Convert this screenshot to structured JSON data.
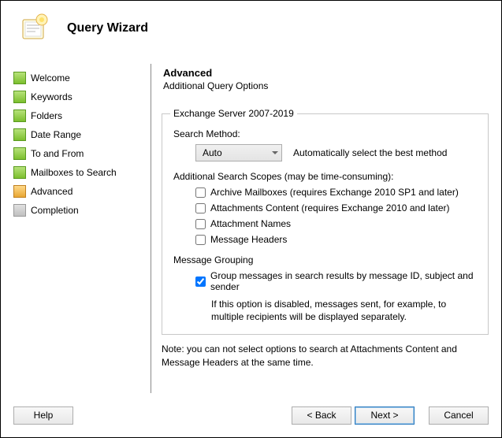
{
  "header": {
    "title": "Query Wizard"
  },
  "sidebar": {
    "items": [
      {
        "label": "Welcome",
        "state": "done"
      },
      {
        "label": "Keywords",
        "state": "done"
      },
      {
        "label": "Folders",
        "state": "done"
      },
      {
        "label": "Date Range",
        "state": "done"
      },
      {
        "label": "To and From",
        "state": "done"
      },
      {
        "label": "Mailboxes to Search",
        "state": "done"
      },
      {
        "label": "Advanced",
        "state": "current"
      },
      {
        "label": "Completion",
        "state": "pending"
      }
    ]
  },
  "main": {
    "heading": "Advanced",
    "subheading": "Additional Query Options",
    "group": {
      "title": "Exchange Server 2007-2019",
      "searchMethodLabel": "Search Method:",
      "searchMethodValue": "Auto",
      "searchMethodHint": "Automatically select the best method",
      "scopesLabel": "Additional Search Scopes (may be time-consuming):",
      "scopes": [
        {
          "label": "Archive Mailboxes (requires Exchange 2010 SP1 and later)",
          "checked": false
        },
        {
          "label": "Attachments Content (requires Exchange 2010 and later)",
          "checked": false
        },
        {
          "label": "Attachment Names",
          "checked": false
        },
        {
          "label": "Message Headers",
          "checked": false
        }
      ],
      "groupingLabel": "Message Grouping",
      "grouping": {
        "label": "Group messages in search results by message ID, subject and sender",
        "checked": true,
        "note": "If this option is disabled, messages sent, for example, to multiple recipients will be displayed separately."
      }
    },
    "note": "Note: you can not select options to search at Attachments Content and Message Headers at the same time."
  },
  "buttons": {
    "help": "Help",
    "back": "< Back",
    "next": "Next >",
    "cancel": "Cancel"
  }
}
